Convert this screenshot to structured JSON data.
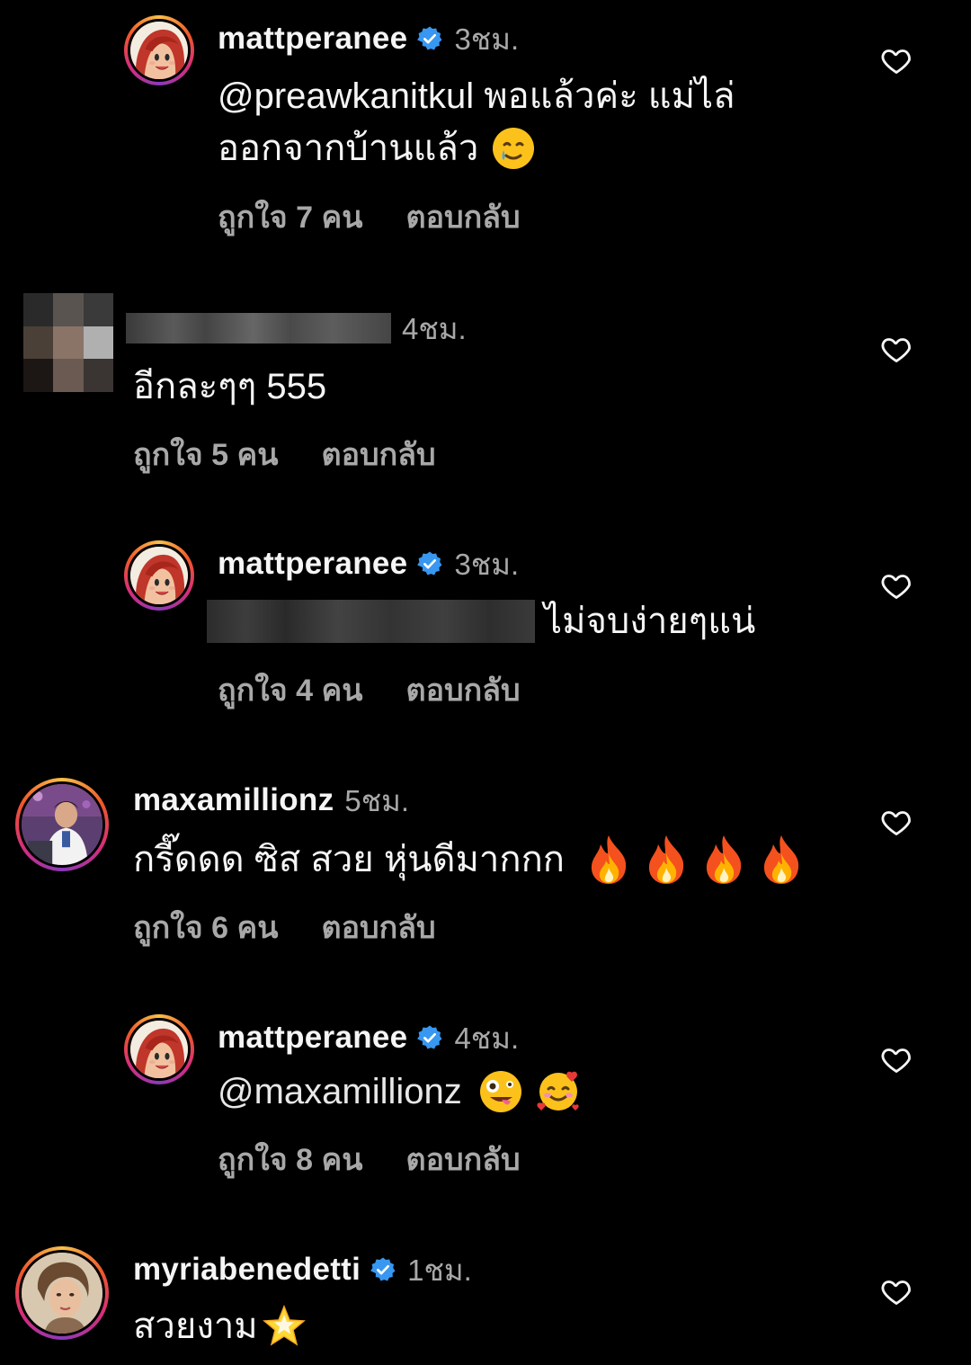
{
  "comments": [
    {
      "username": "mattperanee",
      "time": "3ชม.",
      "text_line1": "@preawkanitkul พอแล้วค่ะ แม่ไล่",
      "text_line2": "ออกจากบ้านแล้ว",
      "likes": "ถูกใจ 7 คน",
      "reply": "ตอบกลับ",
      "emoji": "crying-smile"
    },
    {
      "username": "",
      "time": "4ชม.",
      "text": "อีกละๆๆ 555",
      "likes": "ถูกใจ 5 คน",
      "reply": "ตอบกลับ"
    },
    {
      "username": "mattperanee",
      "time": "3ชม.",
      "text": "ไม่จบง่ายๆแน่",
      "likes": "ถูกใจ 4 คน",
      "reply": "ตอบกลับ"
    },
    {
      "username": "maxamillionz",
      "time": "5ชม.",
      "text": "กรี๊ดดด ซิส สวย หุ่นดีมากกก",
      "likes": "ถูกใจ 6 คน",
      "reply": "ตอบกลับ",
      "emoji": "fire x4"
    },
    {
      "username": "mattperanee",
      "time": "4ชม.",
      "text": "@maxamillionz",
      "likes": "ถูกใจ 8 คน",
      "reply": "ตอบกลับ",
      "emoji": "zany-face, smiling-face-with-hearts"
    },
    {
      "username": "myriabenedetti",
      "time": "1ชม.",
      "text": "สวยงาม",
      "emoji": "glowing-star"
    }
  ],
  "colors": {
    "background": "#000000",
    "primary_text": "#f5f5f5",
    "secondary_text": "#a8a8a8",
    "verified_blue": "#3897f0"
  },
  "icons": [
    "heart-icon",
    "verified-badge-icon"
  ]
}
